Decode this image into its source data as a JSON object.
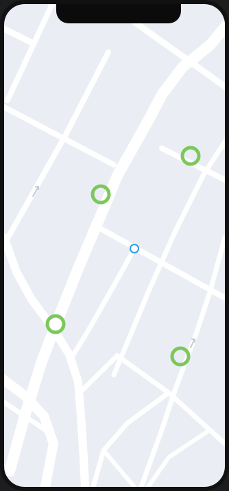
{
  "colors": {
    "map_background": "#eaeef4",
    "street": "#ffffff",
    "marker_ring": "#7cc85a",
    "current_location": "#2f9be6",
    "street_arrow": "#c7cbd1"
  },
  "icons": {
    "notch": "phone-notch",
    "marker": "map-marker-ring",
    "current_location": "current-location-dot",
    "arrow": "street-direction-arrow"
  }
}
